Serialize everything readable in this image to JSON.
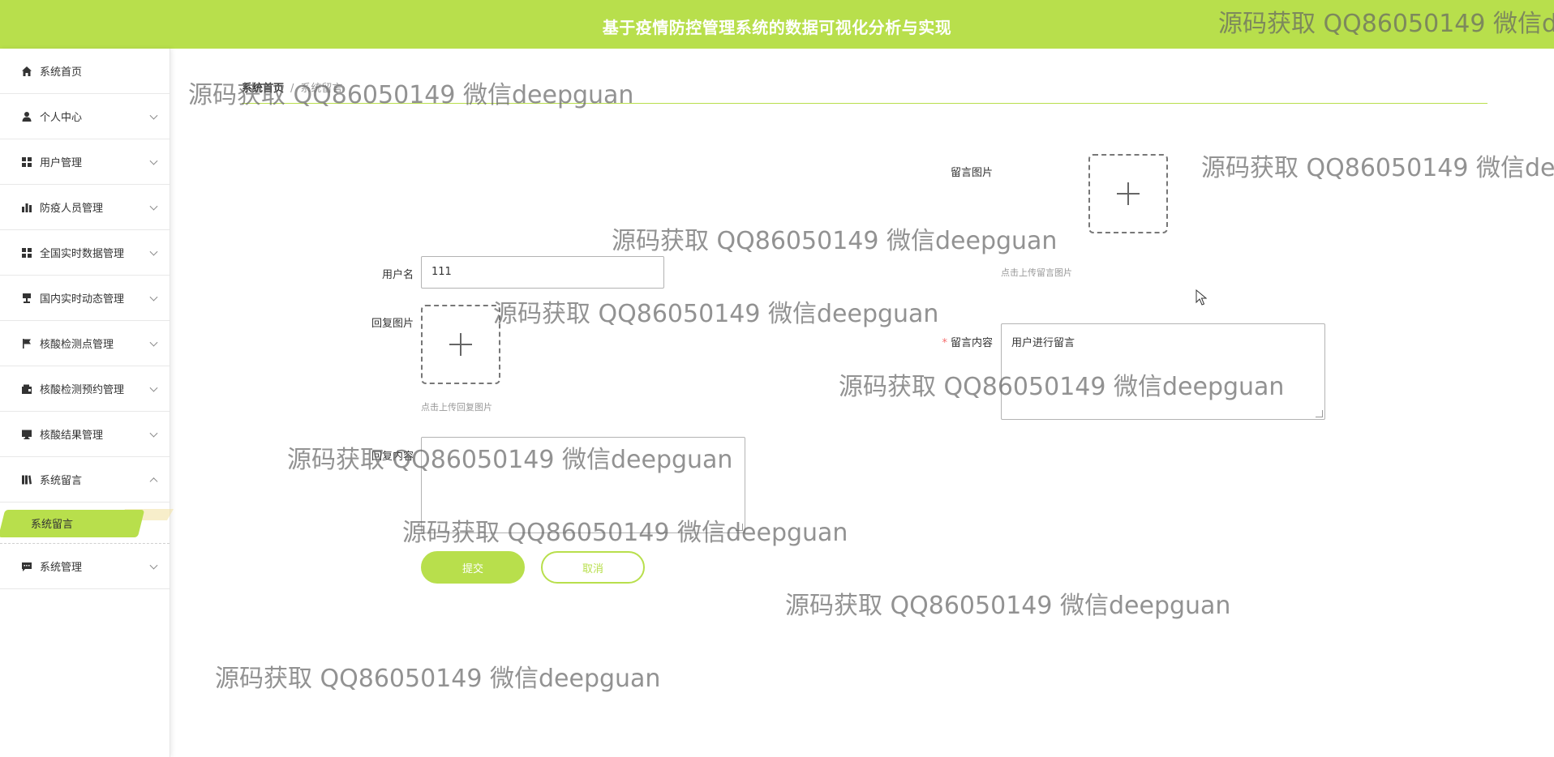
{
  "header": {
    "title": "基于疫情防控管理系统的数据可视化分析与实现",
    "links": [
      "",
      "",
      ""
    ]
  },
  "sidebar": {
    "items": [
      {
        "label": "系统首页",
        "icon": "home-icon",
        "chevron": false
      },
      {
        "label": "个人中心",
        "icon": "user-icon",
        "chevron": true
      },
      {
        "label": "用户管理",
        "icon": "grid-icon",
        "chevron": true
      },
      {
        "label": "防疫人员管理",
        "icon": "bar-chart-icon",
        "chevron": true
      },
      {
        "label": "全国实时数据管理",
        "icon": "grid-icon",
        "chevron": true
      },
      {
        "label": "国内实时动态管理",
        "icon": "stamp-icon",
        "chevron": true
      },
      {
        "label": "核酸检测点管理",
        "icon": "flag-icon",
        "chevron": true
      },
      {
        "label": "核酸检测预约管理",
        "icon": "wallet-icon",
        "chevron": true
      },
      {
        "label": "核酸结果管理",
        "icon": "monitor-icon",
        "chevron": true
      },
      {
        "label": "系统留言",
        "icon": "book-icon",
        "chevron": true,
        "expanded": true
      },
      {
        "label": "系统管理",
        "icon": "chat-icon",
        "chevron": true
      }
    ],
    "submenu": {
      "label": "系统留言"
    }
  },
  "breadcrumb": {
    "home": "系统首页",
    "separator": "/",
    "current": "系统留言"
  },
  "form": {
    "message_image_label": "留言图片",
    "message_image_tip": "点击上传留言图片",
    "username_label": "用户名",
    "username_value": "111",
    "reply_image_label": "回复图片",
    "reply_image_tip": "点击上传回复图片",
    "message_content_label": "留言内容",
    "message_content_value": "用户进行留言",
    "reply_content_label": "回复内容",
    "reply_content_value": "",
    "submit_label": "提交",
    "cancel_label": "取消"
  },
  "watermark": {
    "text": "源码获取 QQ86050149 微信deepguan"
  },
  "colors": {
    "accent": "#b8df4c",
    "required": "#f56c6c"
  }
}
